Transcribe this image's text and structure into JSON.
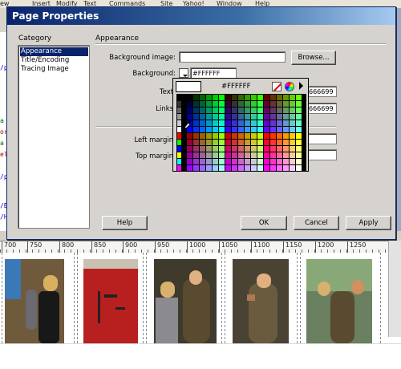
{
  "window": {
    "title": "Page Properties"
  },
  "menubar": [
    "ew",
    "Insert",
    "Modify",
    "Text",
    "Commands",
    "Site",
    "Yahoo!",
    "Window",
    "Help"
  ],
  "code_fragments": [
    "/p",
    "a",
    "or",
    "a",
    "el",
    "/p",
    "/B",
    "/H"
  ],
  "category": {
    "label": "Category",
    "items": [
      "Appearance",
      "Title/Encoding",
      "Tracing Image"
    ],
    "selected": "Appearance"
  },
  "appearance": {
    "heading": "Appearance",
    "background_image_label": "Background image:",
    "background_image_value": "",
    "browse_label": "Browse...",
    "background_label": "Background:",
    "background_value": "#FFFFFF",
    "text_label": "Text:",
    "text_value": "666699",
    "links_label": "Links:",
    "links_value": "666699",
    "left_margin_label": "Left margin:",
    "left_margin_value": "",
    "top_margin_label": "Top margin:",
    "top_margin_value": ""
  },
  "buttons": {
    "help": "Help",
    "ok": "OK",
    "cancel": "Cancel",
    "apply": "Apply"
  },
  "color_picker": {
    "hex": "#FFFFFF",
    "preview_color": "#FFFFFF",
    "icons": [
      "no-color-icon",
      "system-color-wheel-icon",
      "picker-menu-icon"
    ]
  },
  "ruler": {
    "ticks": [
      "700",
      "750",
      "800",
      "850",
      "900",
      "950",
      "1000",
      "1050",
      "1100",
      "1150",
      "1200",
      "1250"
    ]
  },
  "photos": [
    {
      "name": "photo-girl-blonde",
      "bg": "#6f5a3c"
    },
    {
      "name": "photo-red-board",
      "bg": "#b82020"
    },
    {
      "name": "photo-woman-coat-1",
      "bg": "#3e3a2c"
    },
    {
      "name": "photo-woman-coat-2",
      "bg": "#4a4232"
    },
    {
      "name": "photo-woman-coat-3",
      "bg": "#6a8060"
    }
  ],
  "colors": {
    "title_start": "#0a246a",
    "title_end": "#a6caf0",
    "selection": "#0a246a",
    "dialog_bg": "#d6d3ce"
  }
}
